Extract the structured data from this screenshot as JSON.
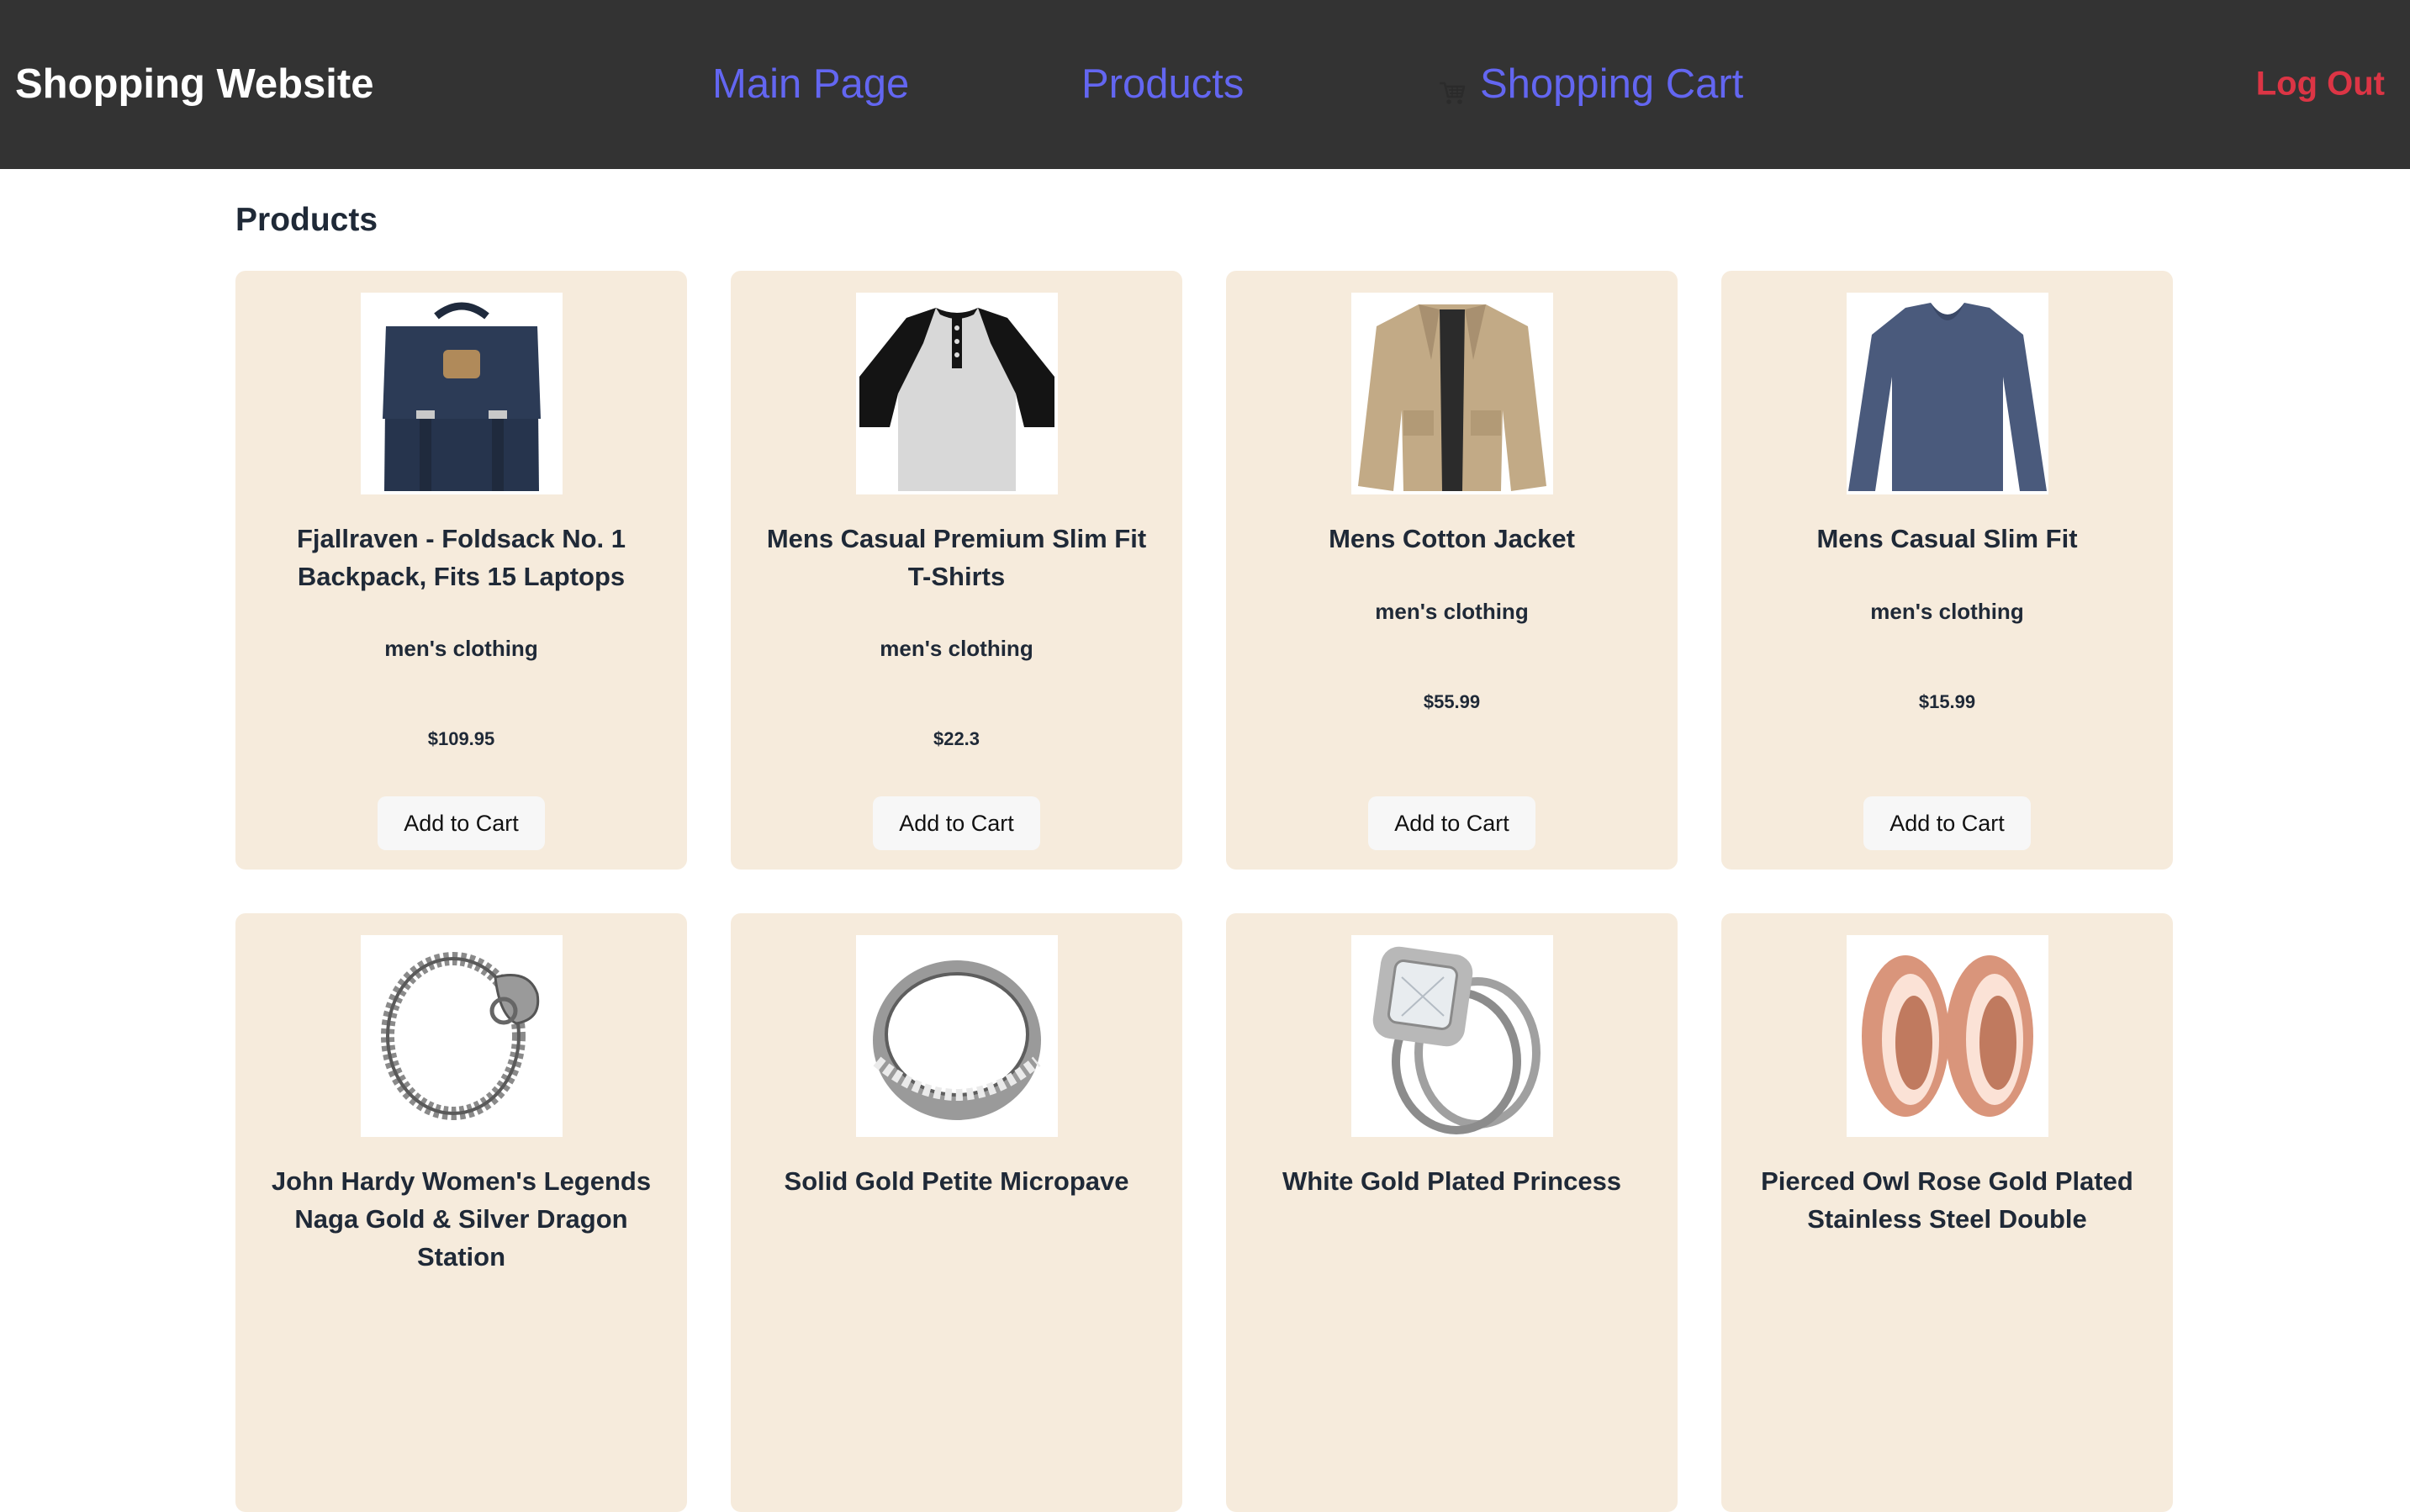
{
  "nav": {
    "brand": "Shopping Website",
    "main_page": "Main Page",
    "products": "Products",
    "shopping_cart": "Shopping Cart",
    "log_out": "Log Out",
    "cart_icon": "shopping-cart-icon"
  },
  "page": {
    "title": "Products"
  },
  "products": [
    {
      "title": "Fjallraven - Foldsack No. 1 Backpack, Fits 15 Laptops",
      "category": "men's clothing",
      "price": "$109.95",
      "button": "Add to Cart",
      "image": "backpack-image"
    },
    {
      "title": "Mens Casual Premium Slim Fit T-Shirts",
      "category": "men's clothing",
      "price": "$22.3",
      "button": "Add to Cart",
      "image": "tshirt-image"
    },
    {
      "title": "Mens Cotton Jacket",
      "category": "men's clothing",
      "price": "$55.99",
      "button": "Add to Cart",
      "image": "jacket-image"
    },
    {
      "title": "Mens Casual Slim Fit",
      "category": "men's clothing",
      "price": "$15.99",
      "button": "Add to Cart",
      "image": "longsleeve-image"
    },
    {
      "title": "John Hardy Women's Legends Naga Gold & Silver Dragon Station",
      "category": "",
      "price": "",
      "button": "",
      "image": "bracelet-image"
    },
    {
      "title": "Solid Gold Petite Micropave",
      "category": "",
      "price": "",
      "button": "",
      "image": "ring-image"
    },
    {
      "title": "White Gold Plated Princess",
      "category": "",
      "price": "",
      "button": "",
      "image": "diamond-ring-image"
    },
    {
      "title": "Pierced Owl Rose Gold Plated Stainless Steel Double",
      "category": "",
      "price": "",
      "button": "",
      "image": "earrings-image"
    }
  ],
  "colors": {
    "navbar": "#333333",
    "nav_link": "#6366f1",
    "logout": "#dc3545",
    "card_bg": "#f6ebdc"
  }
}
